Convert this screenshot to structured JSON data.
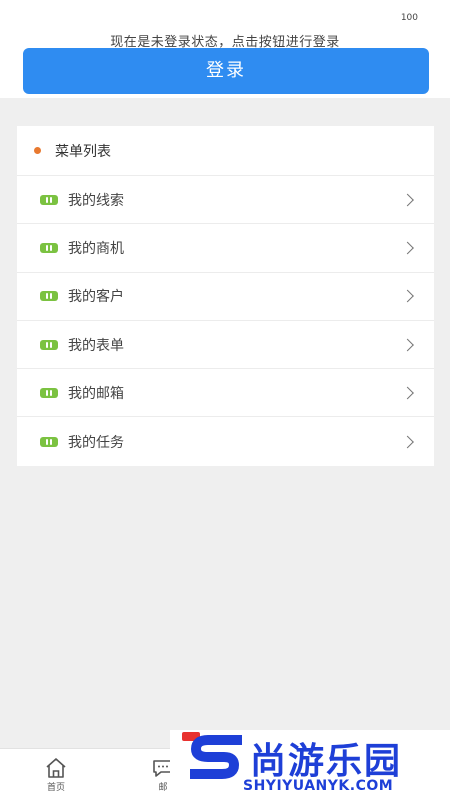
{
  "status_bar": {
    "battery": "100"
  },
  "login": {
    "hint": "现在是未登录状态，点击按钮进行登录",
    "button_label": "登录"
  },
  "menu": {
    "title": "菜单列表",
    "items": [
      {
        "label": "我的线索",
        "icon": "green-tag-icon"
      },
      {
        "label": "我的商机",
        "icon": "green-tag-icon"
      },
      {
        "label": "我的客户",
        "icon": "green-tag-icon"
      },
      {
        "label": "我的表单",
        "icon": "green-tag-icon"
      },
      {
        "label": "我的邮箱",
        "icon": "green-tag-icon"
      },
      {
        "label": "我的任务",
        "icon": "green-tag-icon"
      }
    ]
  },
  "tabbar": {
    "tabs": [
      {
        "label": "首页",
        "icon": "home-icon"
      },
      {
        "label": "邮",
        "icon": "chat-icon"
      }
    ]
  },
  "watermark": {
    "name": "尚游乐园",
    "domain": "SHYIYUANYK.COM"
  },
  "colors": {
    "accent_blue": "#2f8cf1",
    "header_dot": "#e8792f",
    "item_icon_green": "#7bc241",
    "background": "#efefef"
  }
}
